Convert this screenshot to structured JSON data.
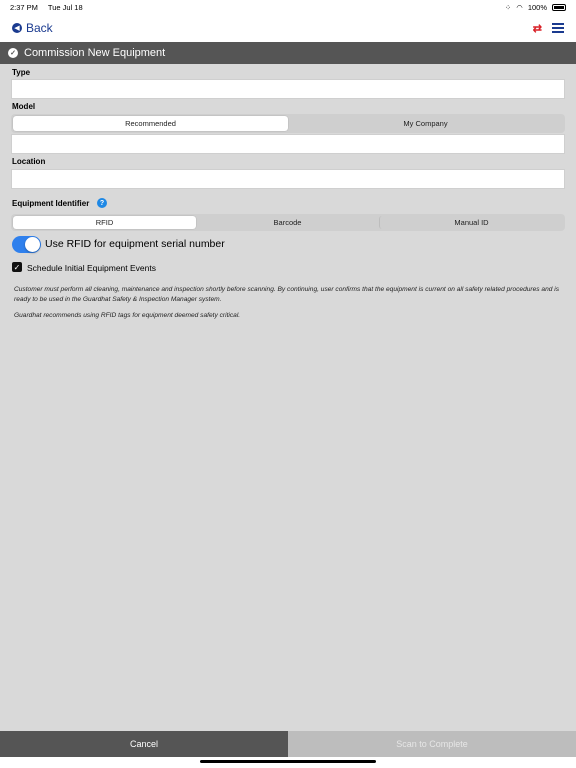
{
  "status_bar": {
    "time": "2:37 PM",
    "date": "Tue Jul 18",
    "battery": "100%"
  },
  "nav": {
    "back_label": "Back"
  },
  "header": {
    "title": "Commission New Equipment"
  },
  "form": {
    "type_label": "Type",
    "model_label": "Model",
    "model_tabs": [
      "Recommended",
      "My Company"
    ],
    "location_label": "Location",
    "identifier_label": "Equipment Identifier",
    "identifier_tabs": [
      "RFID",
      "Barcode",
      "Manual ID"
    ],
    "rfid_toggle_label": "Use RFID for equipment serial number",
    "rfid_toggle_on": true,
    "schedule_label": "Schedule Initial Equipment Events",
    "schedule_checked": true
  },
  "disclaimer": {
    "p1": "Customer must perform all cleaning, maintenance and inspection shortly before scanning. By continuing, user confirms that the equipment is current on all safety related procedures and is ready to be used in the Guardhat Safety & Inspection Manager system.",
    "p2": "Guardhat recommends using RFID tags for equipment deemed safety critical."
  },
  "footer": {
    "cancel_label": "Cancel",
    "scan_label": "Scan to Complete"
  },
  "colors": {
    "accent": "#2f80ed",
    "header_bg": "#555555",
    "nav_blue": "#1a3a8f",
    "sync_red": "#d81f26"
  }
}
